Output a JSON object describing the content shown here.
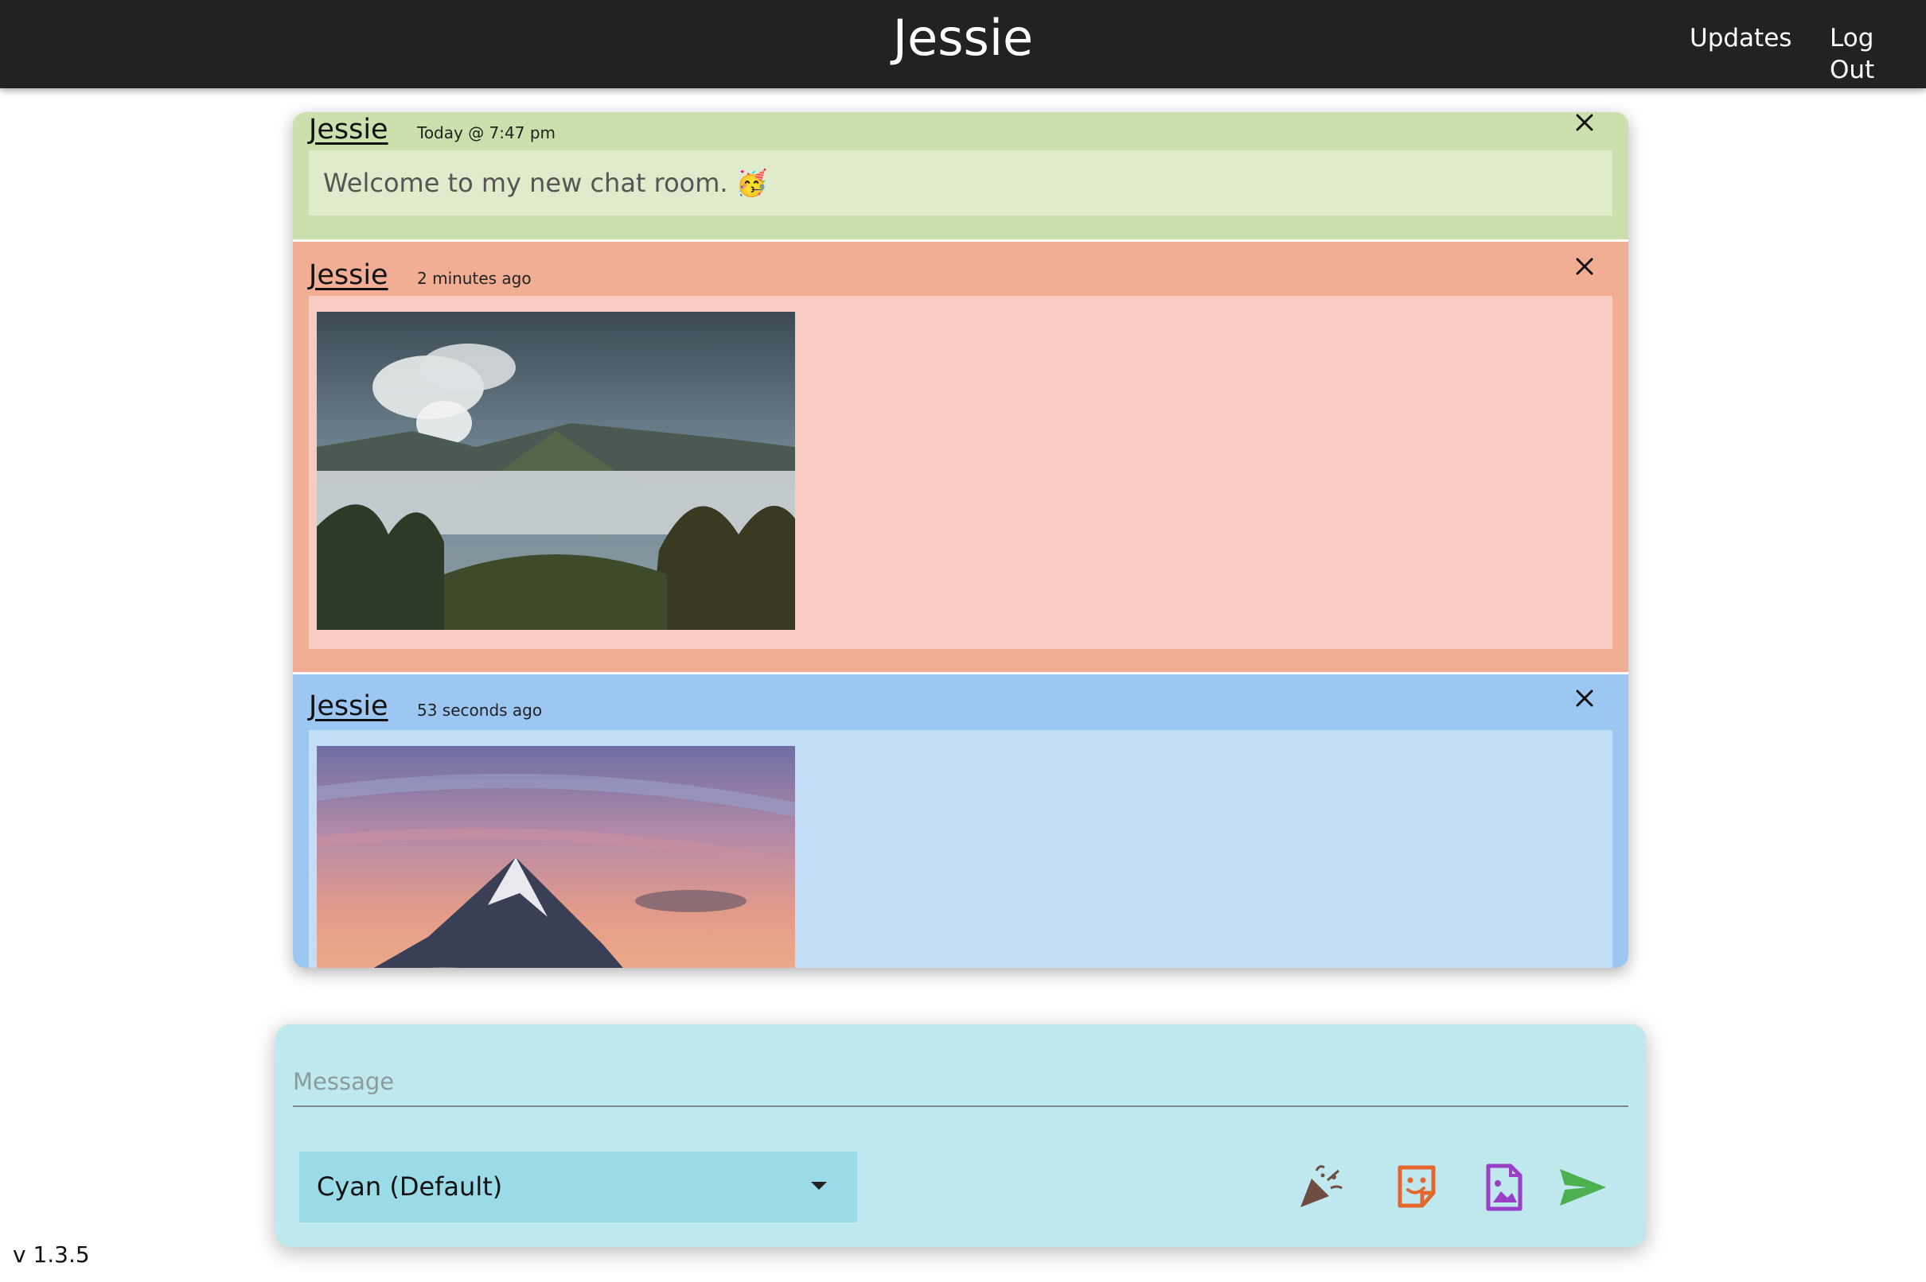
{
  "header": {
    "title": "Jessie",
    "nav": [
      "Updates",
      "Log Out"
    ]
  },
  "messages": [
    {
      "author": "Jessie",
      "time": "Today @ 7:47 pm",
      "text": "Welcome to my new chat room. 🥳",
      "color": "#cce0ad",
      "type": "text"
    },
    {
      "author": "Jessie",
      "time": "2 minutes ago",
      "color": "#f2ae95",
      "type": "image",
      "image": "volcano landscape photo"
    },
    {
      "author": "Jessie",
      "time": "53 seconds ago",
      "color": "#9cc7f2",
      "type": "image",
      "image": "snowy mountain peak at sunset photo"
    }
  ],
  "composer": {
    "placeholder": "Message",
    "color_select": "Cyan (Default)",
    "icons": [
      "party-popper-icon",
      "sticker-icon",
      "image-upload-icon",
      "send-icon"
    ]
  },
  "version": "v 1.3.5"
}
